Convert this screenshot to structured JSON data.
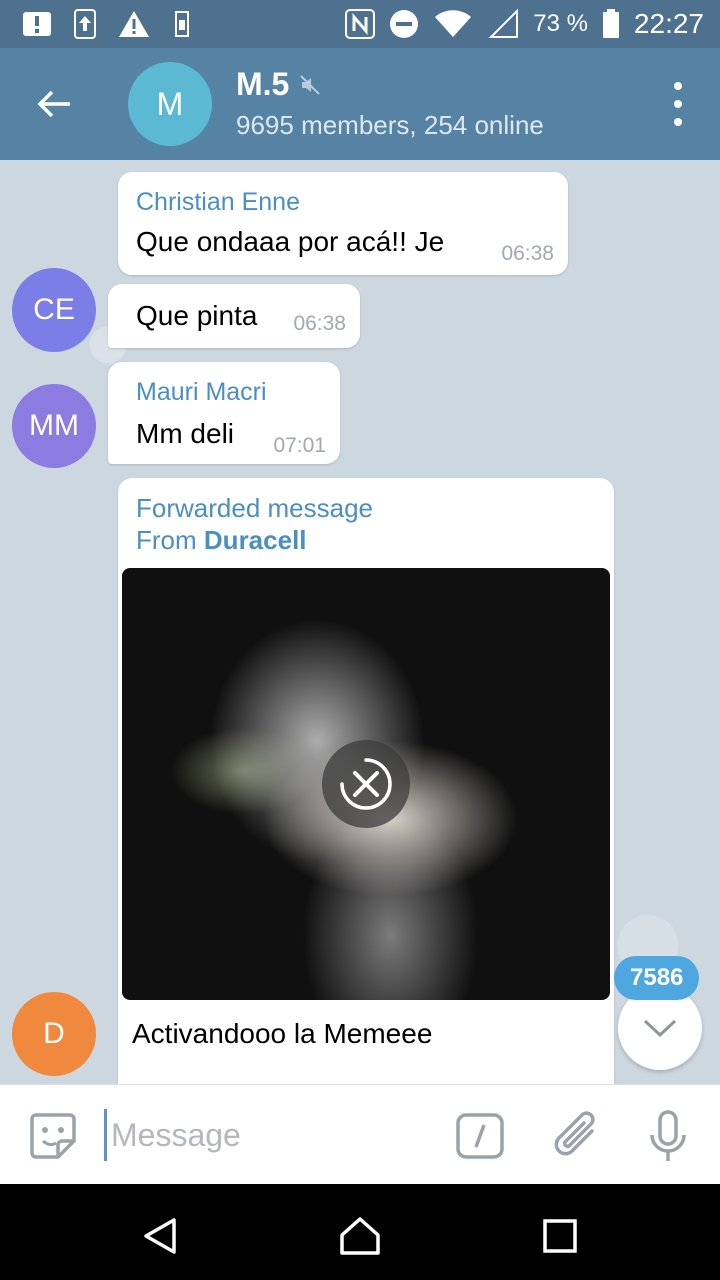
{
  "status_bar": {
    "battery_text": "73 %",
    "time": "22:27"
  },
  "header": {
    "avatar_initial": "M",
    "title": "M.5",
    "subtitle": "9695 members, 254 online"
  },
  "messages": [
    {
      "sender": "Christian Enne",
      "text": "Que ondaaa por acá!! Je",
      "time": "06:38"
    },
    {
      "avatar_initials": "CE",
      "avatar_color": "#7b7ee6",
      "text": "Que pinta",
      "time": "06:38"
    },
    {
      "avatar_initials": "MM",
      "avatar_color": "#8c7be0",
      "sender": "Mauri Macri",
      "text": "Mm deli",
      "time": "07:01"
    }
  ],
  "forwarded": {
    "label": "Forwarded message",
    "from_prefix": "From",
    "from_name": "Duracell",
    "caption": "Activandooo la Memeee",
    "avatar_initials": "D",
    "avatar_color": "#f0883e"
  },
  "unread_count": "7586",
  "input": {
    "placeholder": "Message"
  },
  "colors": {
    "header": "#5682a3",
    "accent": "#4a8fc4"
  }
}
